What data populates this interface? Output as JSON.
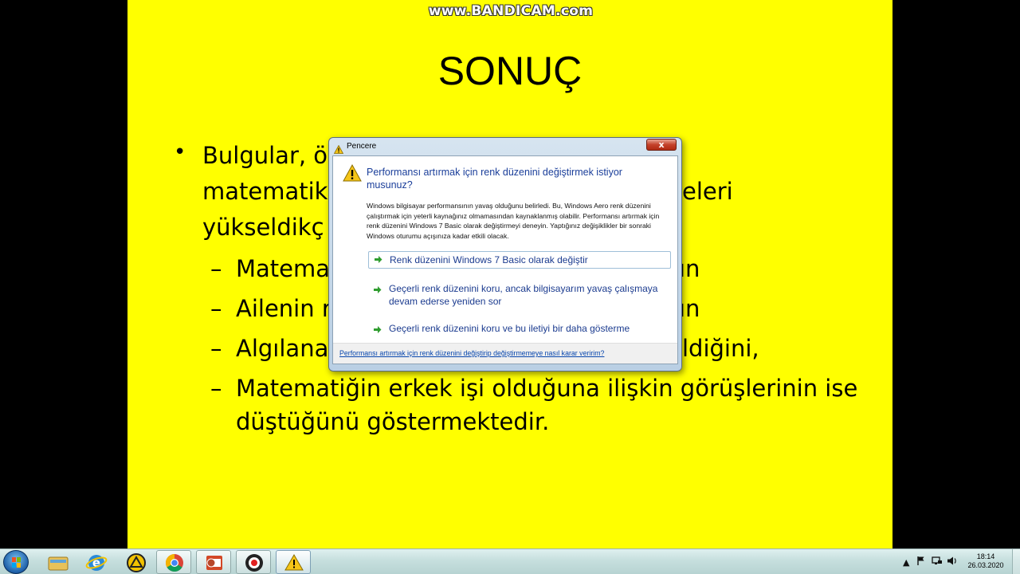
{
  "watermark": "www.BANDICAM.com",
  "slide": {
    "title": "SONUÇ",
    "bullet_dot": "•",
    "lines": [
      "Bulgular, ö",
      "matematik",
      "yükseldikç",
      "eleri",
      "Matema",
      "ın",
      "Ailenin r",
      "ın",
      "Algılana",
      "ldiğini,",
      "Matematiğin erkek işi olduğuna ilişkin görüşlerinin ise",
      "düştüğünü göstermektedir."
    ],
    "dash": "–"
  },
  "dialog": {
    "title": "Pencere",
    "close_label": "x",
    "main_instruction": "Performansı artırmak için renk düzenini değiştirmek istiyor musunuz?",
    "body": "Windows bilgisayar performansının yavaş olduğunu belirledi. Bu, Windows Aero renk düzenini çalıştırmak için yeterli kaynağınız olmamasından kaynaklanmış olabilir. Performansı artırmak için renk düzenini Windows 7 Basic olarak değiştirmeyi deneyin. Yaptığınız değişiklikler bir sonraki Windows oturumu açışınıza kadar etkili olacak.",
    "commands": [
      "Renk düzenini Windows 7 Basic olarak değiştir",
      "Geçerli renk düzenini koru, ancak bilgisayarım yavaş çalışmaya devam ederse yeniden sor",
      "Geçerli renk düzenini koru ve bu iletiyi bir daha gösterme"
    ],
    "footer_link": "Performansı artırmak için renk düzenini değiştirip değiştirmemeye nasıl karar veririm?"
  },
  "taskbar": {
    "apps": [
      {
        "name": "windows-explorer-icon",
        "state": "pinned"
      },
      {
        "name": "internet-explorer-icon",
        "state": "pinned"
      },
      {
        "name": "app-triangle-icon",
        "state": "pinned"
      },
      {
        "name": "chrome-icon",
        "state": "open"
      },
      {
        "name": "powerpoint-icon",
        "state": "open"
      },
      {
        "name": "bandicam-icon",
        "state": "open"
      },
      {
        "name": "warning-window-icon",
        "state": "active"
      }
    ],
    "tray": {
      "show_hidden": "▲",
      "time": "18:14",
      "date": "26.03.2020"
    }
  },
  "colors": {
    "slide_bg": "#ffff00",
    "instruction_blue": "#1a3e9a",
    "link_blue": "#0645ad",
    "arrow_green": "#2f9d2f"
  }
}
